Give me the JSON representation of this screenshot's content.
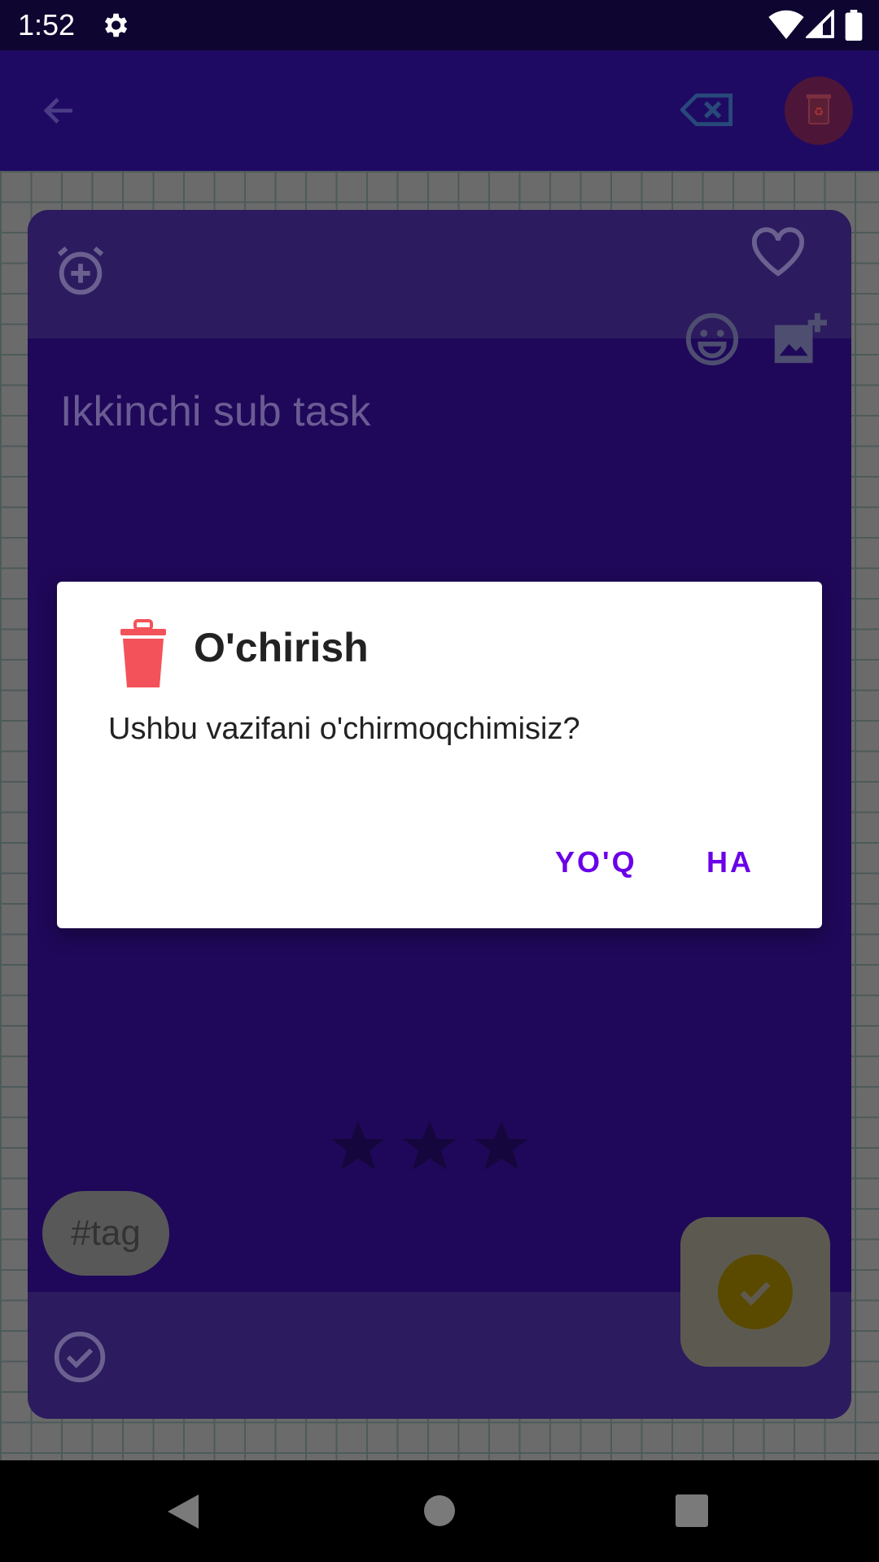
{
  "status_bar": {
    "time": "1:52"
  },
  "app_bar": {
    "back_icon": "arrow-left-icon",
    "clear_icon": "backspace-icon",
    "delete_icon": "recycle-bin-icon"
  },
  "card": {
    "task_title": "Ikkinchi sub task",
    "tag": "#tag",
    "rating": {
      "value": 0,
      "max": 3
    }
  },
  "dialog": {
    "title": "O'chirish",
    "message": "Ushbu vazifani o'chirmoqchimisiz?",
    "no_label": "YO'Q",
    "yes_label": "HA"
  },
  "colors": {
    "accent": "#6a00e8",
    "trash": "#f4525a",
    "app_bar": "#1f0a63"
  }
}
